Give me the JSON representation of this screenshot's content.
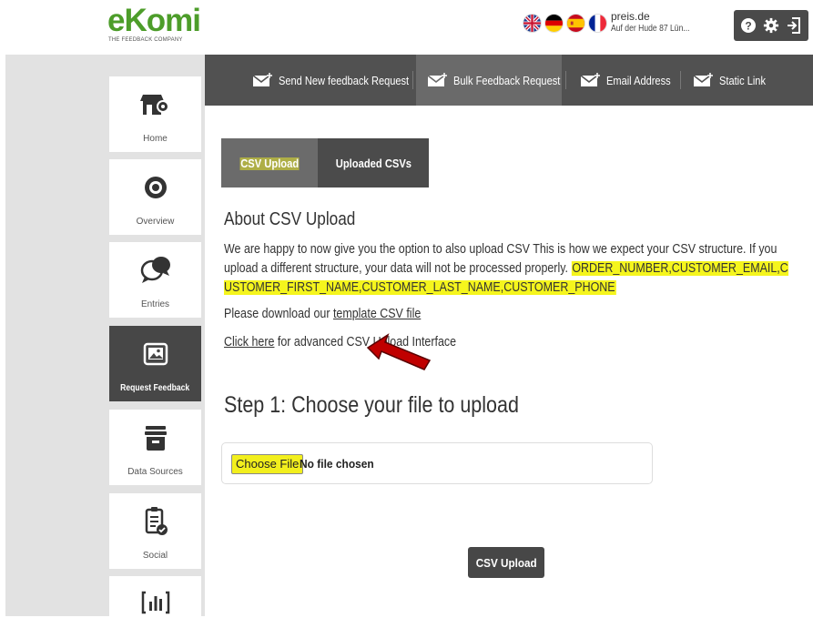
{
  "brand": {
    "name": "eKomi",
    "tagline": "THE FEEDBACK COMPANY"
  },
  "header": {
    "shop_name": "preis.de",
    "shop_address": "Auf der Hude 87 Lün...",
    "languages": [
      "English",
      "German",
      "Spanish",
      "French"
    ],
    "icons": [
      "help-icon",
      "gear-icon",
      "logout-icon"
    ]
  },
  "sidebar": {
    "items": [
      {
        "label": "Home",
        "icon": "store-gear-icon"
      },
      {
        "label": "Overview",
        "icon": "eye-icon"
      },
      {
        "label": "Entries",
        "icon": "chat-bubbles-icon"
      },
      {
        "label": "Request Feedback",
        "icon": "image-frame-icon",
        "active": true
      },
      {
        "label": "Data Sources",
        "icon": "database-bin-icon"
      },
      {
        "label": "Social",
        "icon": "clipboard-check-icon"
      },
      {
        "label": "",
        "icon": "chart-frame-icon"
      }
    ]
  },
  "navbar": {
    "tabs": [
      {
        "label": "Send New feedback Request"
      },
      {
        "label": "Bulk Feedback Request",
        "active": true
      },
      {
        "label": "Email Address"
      },
      {
        "label": "Static Link"
      }
    ]
  },
  "subtabs": {
    "items": [
      {
        "label": "CSV Upload",
        "active": true
      },
      {
        "label": "Uploaded CSVs"
      }
    ]
  },
  "content": {
    "about_title": "About CSV Upload",
    "para_text": "We are happy to now give you the option to also upload CSV This is how we expect your CSV structure. If you upload a different structure, your data will not be processed properly.",
    "para_columns": "ORDER_NUMBER,CUSTOMER_EMAIL,CUSTOMER_FIRST_NAME,CUSTOMER_LAST_NAME,CUSTOMER_PHONE",
    "download_prefix": "Please download our ",
    "download_link": "template CSV file",
    "advanced_link": "Click here",
    "advanced_suffix": " for advanced CSV Upload Interface",
    "step_title": "Step 1: Choose your file to upload",
    "choose_file": "Choose File",
    "no_file": "No file chosen",
    "submit": "CSV Upload"
  },
  "colors": {
    "brand_green": "#4d9d2a",
    "highlight": "#f5f51d",
    "dark": "#474747",
    "arrow_red": "#c00000"
  }
}
